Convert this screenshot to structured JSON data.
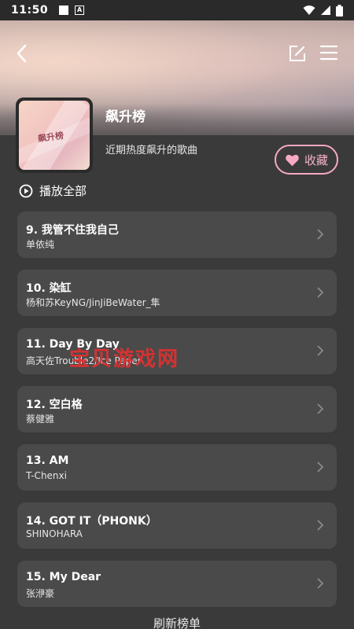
{
  "status": {
    "time": "11:50"
  },
  "header": {
    "back_icon": "chevron-left-icon",
    "edit_icon": "edit-icon",
    "menu_icon": "menu-icon"
  },
  "playlist": {
    "cover_text": "飙升榜",
    "title": "飙升榜",
    "description": "近期热度飙升的歌曲",
    "collect_label": "收藏",
    "accent_color": "#f6a9c4"
  },
  "play_all_label": "播放全部",
  "songs": [
    {
      "title": "9. 我管不住我自己",
      "artist": "单依纯"
    },
    {
      "title": "10. 染缸",
      "artist": "杨和苏KeyNG/JinJiBeWater_隼"
    },
    {
      "title": "11. Day By Day",
      "artist": "高天佐Trouble2/Ice Paper"
    },
    {
      "title": "12. 空白格",
      "artist": "蔡健雅"
    },
    {
      "title": "13. AM",
      "artist": "T-Chenxi"
    },
    {
      "title": "14. GOT IT（PHONK）",
      "artist": "SHINOHARA"
    },
    {
      "title": "15. My Dear",
      "artist": "张洢豪"
    }
  ],
  "watermark": "宝贝游戏网",
  "refresh_label": "刷新榜单"
}
